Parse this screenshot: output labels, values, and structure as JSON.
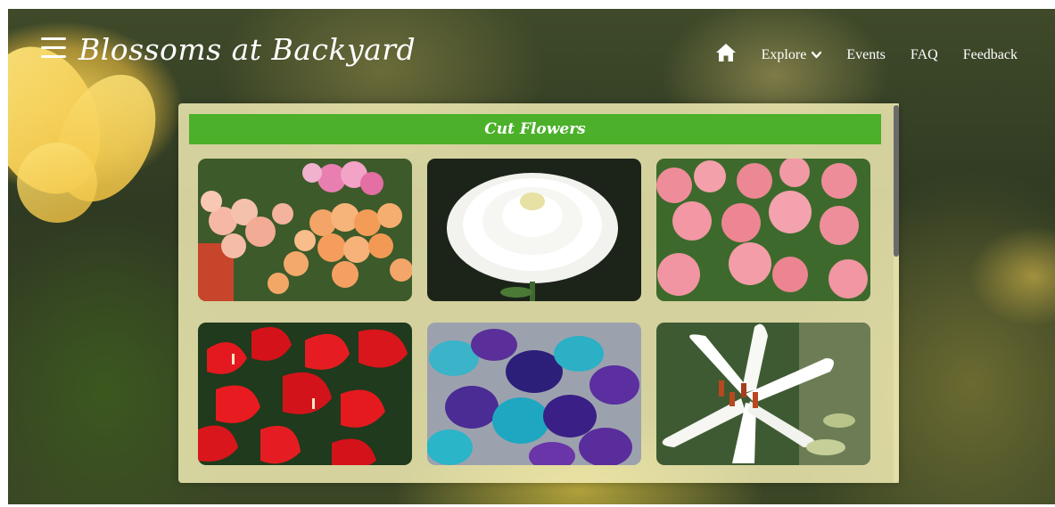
{
  "header": {
    "brand": "Blossoms at Backyard",
    "menu_icon": "hamburger-menu-icon",
    "nav": {
      "home_icon": "home-icon",
      "explore": "Explore",
      "explore_icon": "chevron-down-icon",
      "events": "Events",
      "faq": "FAQ",
      "feedback": "Feedback"
    }
  },
  "main": {
    "section_title": "Cut Flowers",
    "accent_color": "#4cb02a",
    "tiles": [
      {
        "name": "roses-image"
      },
      {
        "name": "chrysanthemum-image"
      },
      {
        "name": "carnations-image"
      },
      {
        "name": "anthuriums-image"
      },
      {
        "name": "orchids-image"
      },
      {
        "name": "lily-image"
      }
    ]
  }
}
